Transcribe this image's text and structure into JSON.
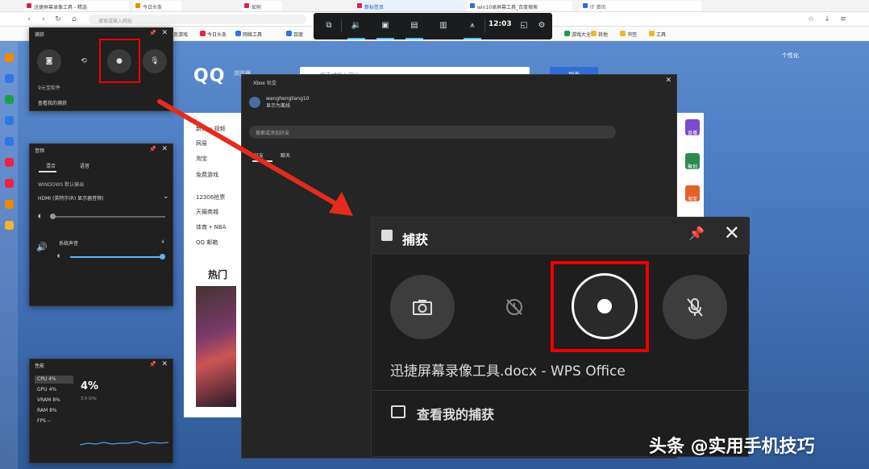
{
  "browser": {
    "tabs": [
      {
        "label": "迅捷屏幕录像工具 - 精选",
        "style": ""
      },
      {
        "label": "今日头条",
        "style": "orange"
      },
      {
        "label": "如何",
        "style": ""
      },
      {
        "label": "新标签页",
        "style": "active"
      },
      {
        "label": "win10录屏幕工具_百度搜索",
        "style": "blue"
      },
      {
        "label": "IT 资讯",
        "style": "blue"
      }
    ],
    "address_placeholder": "搜索或输入网址",
    "bookmarks": [
      {
        "label": "网页游戏",
        "style": ""
      },
      {
        "label": "今日头条",
        "style": ""
      },
      {
        "label": "网络工具",
        "style": "blue"
      },
      {
        "label": "百度",
        "style": "blue"
      },
      {
        "label": "游戏大全",
        "style": "green"
      },
      {
        "label": "其他",
        "style": "folder"
      },
      {
        "label": "书签",
        "style": "folder"
      },
      {
        "label": "工具",
        "style": "folder"
      }
    ]
  },
  "gamebar": {
    "time": "12:03"
  },
  "qq": {
    "logo": "QQ",
    "logo_sub": "浏览器",
    "search_placeholder": "搜索或输入网址",
    "search_button": "搜索",
    "top_links": "个性化",
    "lines": [
      "新闻 • 视频",
      "网易",
      "淘宝",
      "免费游戏",
      "12306抢票",
      "天猫商城",
      "体育 • NBA",
      "QQ 邮箱"
    ],
    "heat_title": "热门",
    "badges": [
      {
        "label": "直播",
        "color": "#7a4ad0"
      },
      {
        "label": "聚划",
        "color": "#2d8a4e"
      },
      {
        "label": "淘宝",
        "color": "#e3622a"
      }
    ]
  },
  "capture_small": {
    "title": "捕获",
    "app_label": "9元宝软件",
    "link": "查看我的捕获"
  },
  "audio": {
    "title": "音频",
    "tab_mix": "混合",
    "tab_voice": "语音",
    "device_label": "WINDOWS 默认输出",
    "device": "HDMI (英特尔(R) 显示器音频)",
    "system_label": "系统声音",
    "system_value": "4"
  },
  "perf": {
    "title": "性能",
    "rows": [
      {
        "label": "CPU 4%",
        "selected": true
      },
      {
        "label": "GPU 4%",
        "selected": false
      },
      {
        "label": "VRAM 8%",
        "selected": false
      },
      {
        "label": "RAM 8%",
        "selected": false
      },
      {
        "label": "FPS --",
        "selected": false
      }
    ],
    "big_value": "4%",
    "big_sub": "3.9 GHz"
  },
  "xbox": {
    "title": "Xbox 社交",
    "username": "wanghengliang10",
    "status": "显示为离线",
    "search_placeholder": "搜索或添加好友",
    "tab_friends": "好友",
    "tab_chat": "聊天"
  },
  "capture_big": {
    "title": "捕获",
    "filename": "迅捷屏幕录像工具.docx - WPS Office",
    "link": "查看我的捕获"
  },
  "watermark": "头条 @实用手机技巧",
  "colors": {
    "highlight_red": "#e00000",
    "panel_dark": "#1e1e1e",
    "accent_blue": "#4cc2ff"
  }
}
